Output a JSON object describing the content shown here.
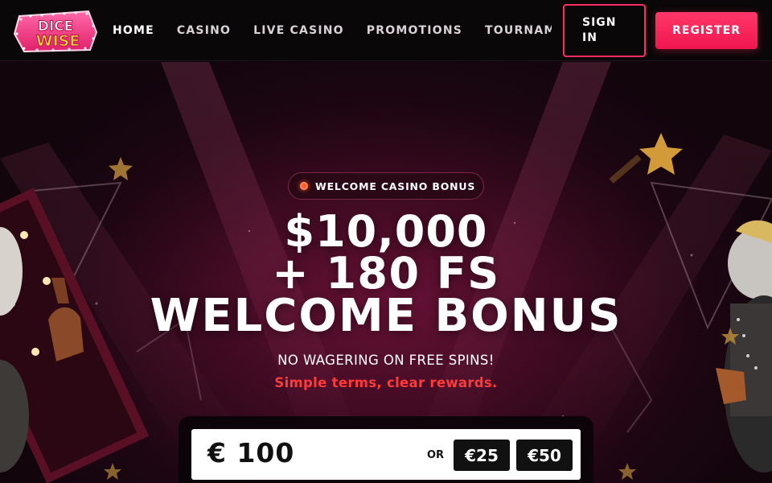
{
  "brand": {
    "logo_line1": "DICE",
    "logo_line2": "WISE",
    "colors": {
      "accent": "#ff2c63",
      "logo_yellow": "#ffd23a",
      "logo_pink": "#ff3a8a",
      "hero_red_text": "#ff3a3a"
    }
  },
  "nav": {
    "items": [
      "HOME",
      "CASINO",
      "LIVE CASINO",
      "PROMOTIONS",
      "TOURNAMENTS"
    ],
    "active": "HOME"
  },
  "auth": {
    "signin_label": "SIGN IN",
    "register_label": "REGISTER"
  },
  "hero": {
    "badge": "WELCOME CASINO BONUS",
    "headline_line1": "$10,000",
    "headline_line2": "+ 180 FS",
    "headline_line3": "WELCOME BONUS",
    "subtitle": "NO WAGERING ON FREE SPINS!",
    "tagline": "Simple terms, clear rewards.",
    "deposit": {
      "amount": "€ 100",
      "or_label": "OR",
      "chips": [
        "€25",
        "€50"
      ]
    }
  },
  "icons": [
    "status-dot-icon",
    "star-icon",
    "logo-icon"
  ]
}
